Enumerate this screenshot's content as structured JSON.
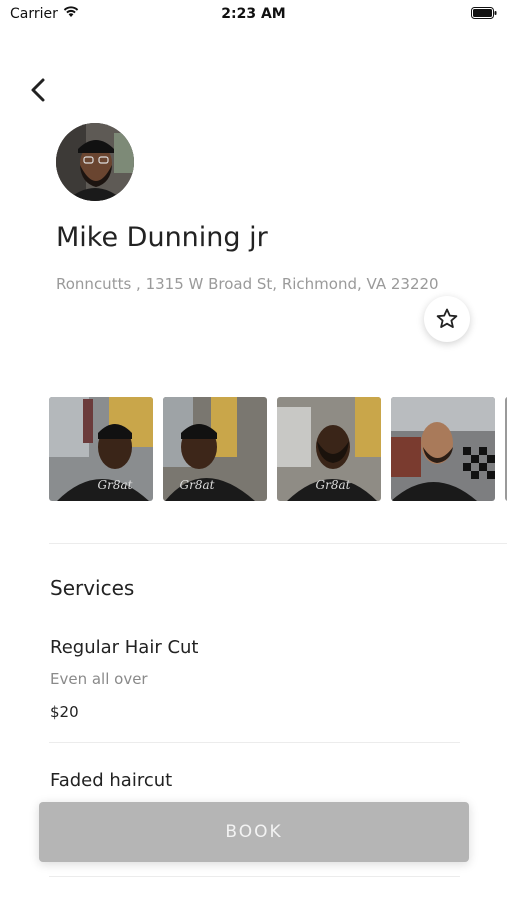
{
  "status_bar": {
    "carrier": "Carrier",
    "time": "2:23 AM"
  },
  "profile": {
    "name": "Mike Dunning jr",
    "address": "Ronncutts , 1315 W Broad St, Richmond, VA 23220"
  },
  "gallery": {
    "watermark": "Gr8at"
  },
  "services": {
    "heading": "Services",
    "items": [
      {
        "name": "Regular Hair Cut",
        "description": "Even all over",
        "price": "$20"
      },
      {
        "name": "Faded haircut"
      }
    ]
  },
  "book_button": {
    "label": "BOOK"
  },
  "icons": {
    "back": "chevron-left-icon",
    "favorite": "star-outline-icon",
    "wifi": "wifi-icon",
    "battery": "battery-icon"
  },
  "colors": {
    "book_button": "#b5b5b5",
    "address_text": "#9a9a9a"
  }
}
